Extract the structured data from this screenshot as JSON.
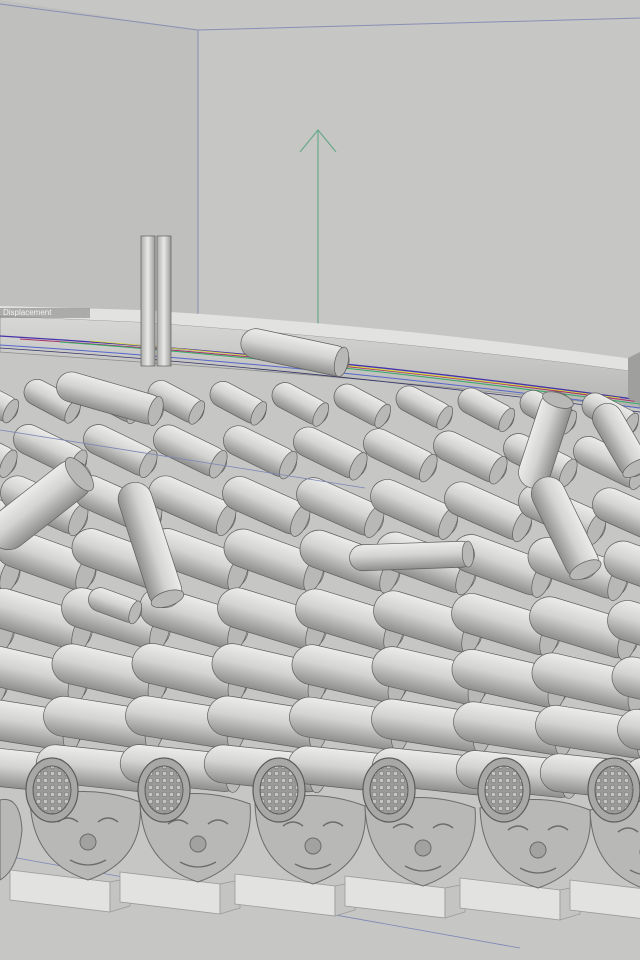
{
  "viewport": {
    "object_label": "Displacement",
    "background_color": "#c6c6c4",
    "floor_color": "#a4a4a2",
    "tile_color": "#d2d2d0",
    "tile_shade_color": "#8d8d8b",
    "outline_color": "#5f5f5d",
    "axis_y_color": "#6aa98c",
    "guide_line_color": "#7c85b8",
    "spline_colors": [
      "#4433aa",
      "#aa3366",
      "#33aa66",
      "#dddd22",
      "#5566cc"
    ]
  }
}
